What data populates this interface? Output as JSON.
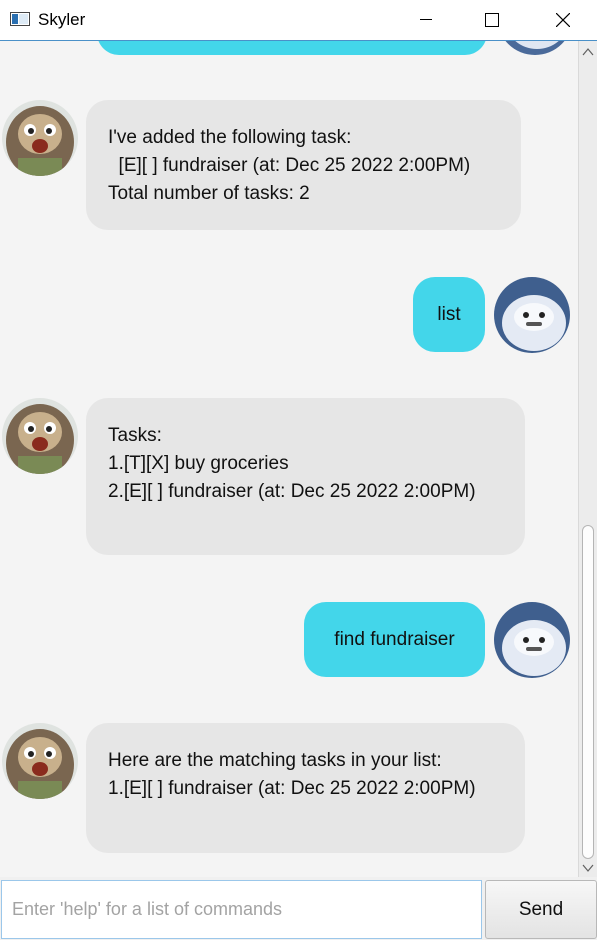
{
  "window": {
    "title": "Skyler"
  },
  "messages": [
    {
      "sender": "bot",
      "text": "I've added the following task:\n  [E][ ] fundraiser (at: Dec 25 2022 2:00PM)\nTotal number of tasks: 2"
    },
    {
      "sender": "user",
      "text": "list"
    },
    {
      "sender": "bot",
      "text": "Tasks:\n1.[T][X] buy groceries\n2.[E][ ] fundraiser (at: Dec 25 2022 2:00PM)"
    },
    {
      "sender": "user",
      "text": "find fundraiser"
    },
    {
      "sender": "bot",
      "text": "Here are the matching tasks in your list:\n1.[E][ ] fundraiser (at: Dec 25 2022 2:00PM)"
    }
  ],
  "input": {
    "placeholder": "Enter 'help' for a list of commands",
    "value": ""
  },
  "send_button": {
    "label": "Send"
  },
  "colors": {
    "user_bubble": "#43d6ea",
    "bot_bubble": "#e6e6e6",
    "chat_background": "#f4f4f4"
  },
  "icons": {
    "app": "app-window-icon",
    "bot_avatar": "sloth-avatar",
    "user_avatar": "yeti-avatar"
  }
}
